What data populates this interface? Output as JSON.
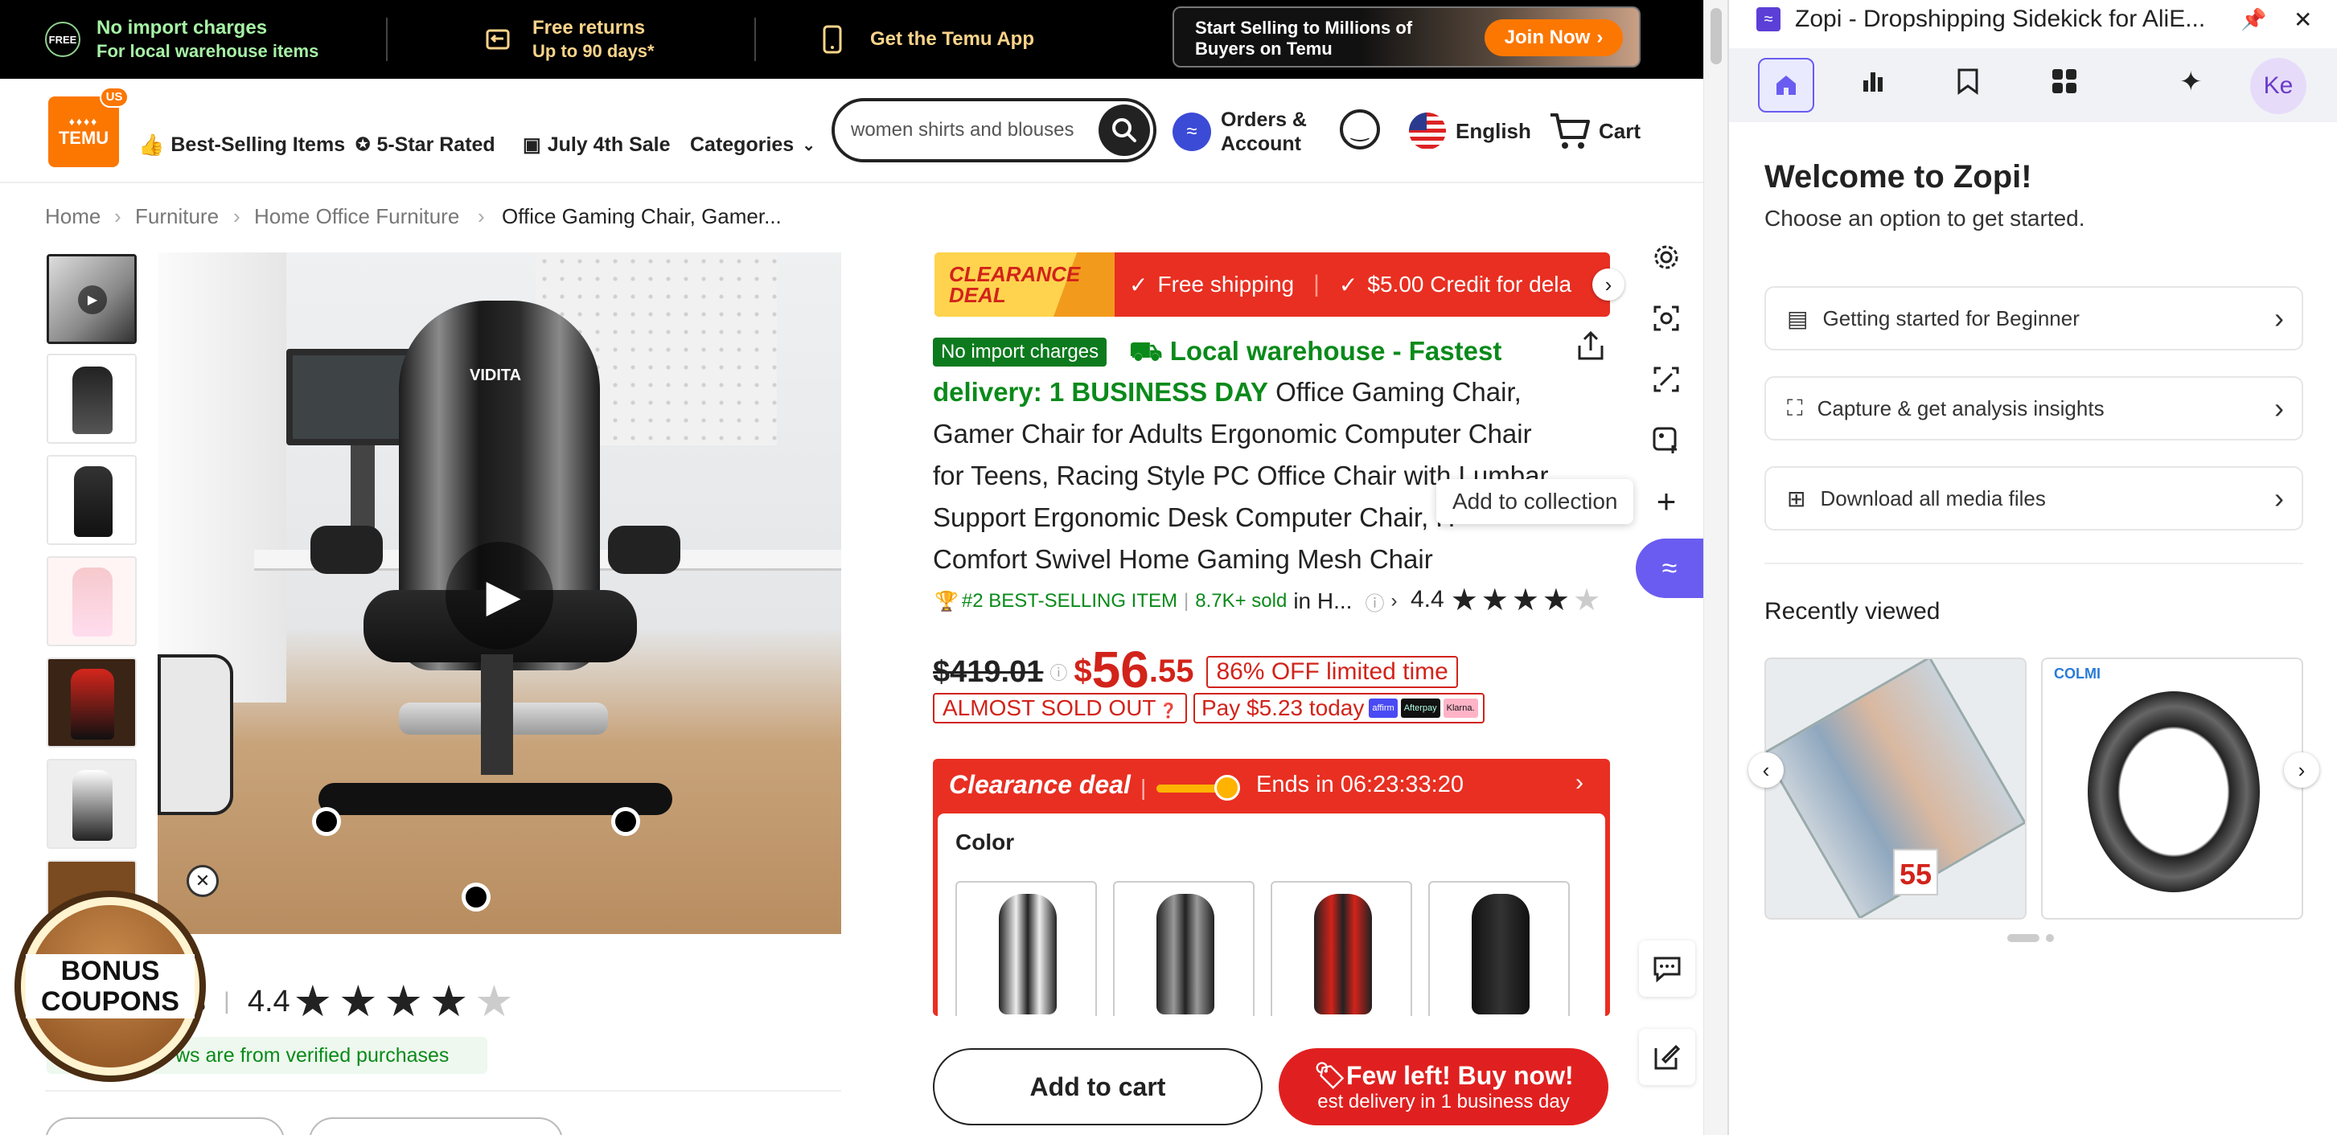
{
  "banner": {
    "free_badge": "FREE",
    "no_import_title": "No import charges",
    "no_import_sub": "For local warehouse items",
    "free_returns_title": "Free returns",
    "free_returns_sub": "Up to 90 days*",
    "app_label": "Get the Temu App",
    "sell_text_1": "Start Selling to Millions of",
    "sell_text_2": "Buyers on Temu",
    "join_label": "Join Now"
  },
  "header": {
    "logo_top": "TEMU",
    "logo_country": "US",
    "nav": [
      "Best-Selling Items",
      "5-Star Rated",
      "July 4th Sale",
      "Categories"
    ],
    "search_placeholder": "women shirts and blouses",
    "orders_line1": "Orders &",
    "orders_line2": "Account",
    "language": "English",
    "cart": "Cart"
  },
  "breadcrumb": [
    "Home",
    "Furniture",
    "Home Office Furniture",
    "Office Gaming Chair, Gamer..."
  ],
  "product": {
    "clearance_badge_1": "CLEARANCE",
    "clearance_badge_2": "DEAL",
    "free_shipping": "Free shipping",
    "credit": "$5.00 Credit for dela",
    "no_import_tag": "No import charges",
    "warehouse_line1": "Local warehouse - Fastest",
    "warehouse_line2": "delivery: 1 BUSINESS DAY",
    "title_l1": "Office Gaming Chair,",
    "title_l2": "Gamer Chair for Adults Ergonomic Computer Chair",
    "title_l3": "for Teens, Racing Style PC Office Chair with Lumbar",
    "title_l4": "Support Ergonomic Desk Computer Chair, H",
    "title_l5": "Comfort Swivel Home Gaming Mesh Chair",
    "tooltip": "Add to collection",
    "best_selling": "#2 BEST-SELLING ITEM",
    "sold": "8.7K+ sold",
    "in_cat": "in H...",
    "rating": "4.4",
    "rating_value": 4.4,
    "old_price": "$419.01",
    "price_currency": "$",
    "price_main": "56",
    "price_cents": ".55",
    "discount": "86% OFF limited time",
    "almost_sold": "ALMOST SOLD OUT",
    "pay_today": "Pay $5.23 today",
    "pay_brands": [
      "affirm",
      "Afterpay",
      "Klarna."
    ],
    "clearance_title": "Clearance deal",
    "ends_in": "Ends in 06:23:33:20",
    "color_label": "Color",
    "add_to_cart": "Add to cart",
    "few_left": "Few left! Buy now!",
    "fastest": "est delivery in 1 business day",
    "reviews_rating": "4.4",
    "reviews_partial": "ws",
    "reviews_verified": "ws are from verified purchases",
    "bonus_1": "BONUS",
    "bonus_2": "COUPONS",
    "chair_brand": "VIDITA"
  },
  "zopi": {
    "title": "Zopi - Dropshipping Sidekick for AliE...",
    "avatar": "Ke",
    "welcome": "Welcome to Zopi!",
    "subtitle": "Choose an option to get started.",
    "options": [
      "Getting started for Beginner",
      "Capture & get analysis insights",
      "Download all media files"
    ],
    "recent": "Recently viewed",
    "card2_brand": "COLMI",
    "card1_number": "55"
  },
  "colors": {
    "temu_orange": "#fb7701",
    "deal_red": "#e02020",
    "green": "#0a8a1a",
    "zopi_purple": "#6a5cf0"
  }
}
